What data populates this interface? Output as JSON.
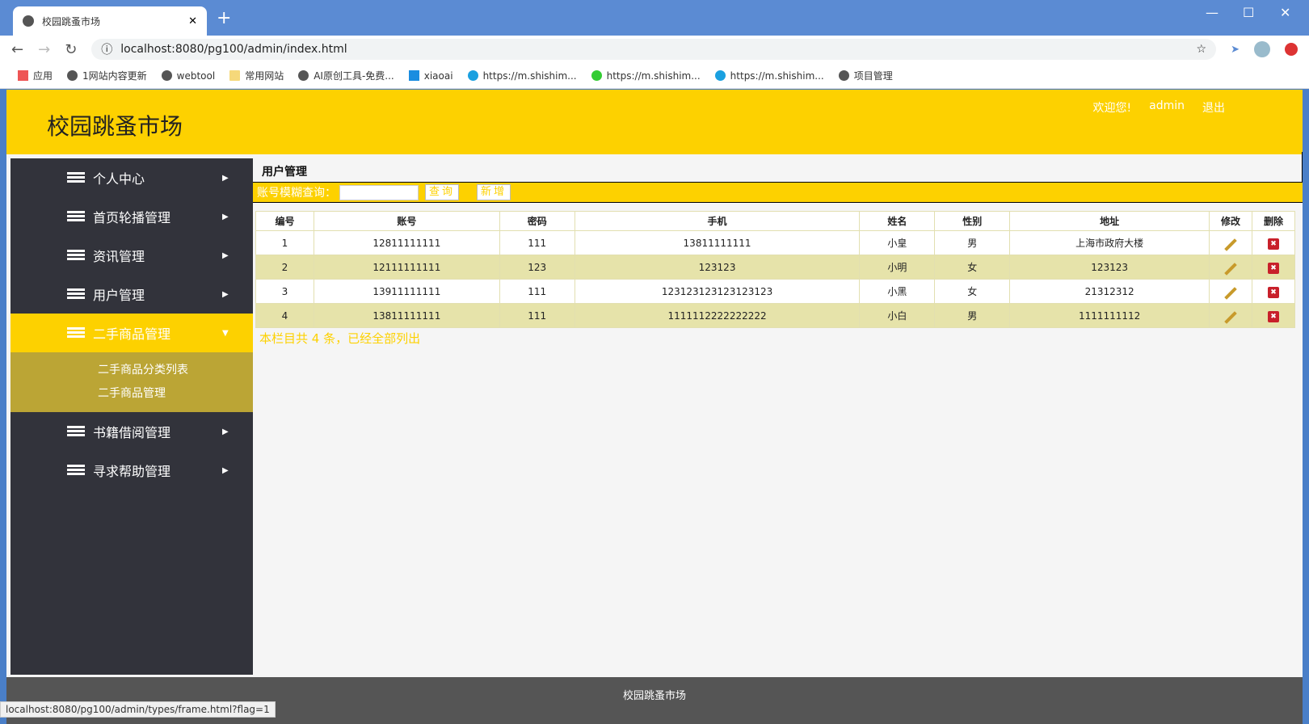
{
  "browser": {
    "tab_title": "校园跳蚤市场",
    "url": "localhost:8080/pg100/admin/index.html",
    "bookmarks": [
      "应用",
      "1网站内容更新",
      "webtool",
      "常用网站",
      "AI原创工具-免费...",
      "xiaoai",
      "https://m.shishim...",
      "https://m.shishim...",
      "https://m.shishim...",
      "项目管理"
    ],
    "status_url": "localhost:8080/pg100/admin/types/frame.html?flag=1"
  },
  "header": {
    "logo": "校园跳蚤市场",
    "welcome": "欢迎您!",
    "user": "admin",
    "logout": "退出"
  },
  "sidebar": {
    "items": [
      {
        "label": "个人中心"
      },
      {
        "label": "首页轮播管理"
      },
      {
        "label": "资讯管理"
      },
      {
        "label": "用户管理"
      },
      {
        "label": "二手商品管理",
        "active": true,
        "children": [
          "二手商品分类列表",
          "二手商品管理"
        ]
      },
      {
        "label": "书籍借阅管理"
      },
      {
        "label": "寻求帮助管理"
      }
    ]
  },
  "main": {
    "title": "用户管理",
    "search_label": "账号模糊查询：",
    "search_value": "",
    "query_btn": "查询",
    "add_btn": "新增",
    "columns": [
      "编号",
      "账号",
      "密码",
      "手机",
      "姓名",
      "性别",
      "地址",
      "修改",
      "删除"
    ],
    "rows": [
      [
        "1",
        "12811111111",
        "111",
        "13811111111",
        "小皇",
        "男",
        "上海市政府大楼"
      ],
      [
        "2",
        "12111111111",
        "123",
        "123123",
        "小明",
        "女",
        "123123"
      ],
      [
        "3",
        "13911111111",
        "111",
        "123123123123123123",
        "小黑",
        "女",
        "21312312"
      ],
      [
        "4",
        "13811111111",
        "111",
        "1111112222222222",
        "小白",
        "男",
        "1111111112"
      ]
    ],
    "count_text": "本栏目共 4 条，已经全部列出"
  },
  "footer": {
    "text": "校园跳蚤市场"
  },
  "colors": {
    "accent": "#fdd100",
    "sidebar": "#32333b",
    "submenu": "#bba535",
    "row_alt": "#e6e3aa"
  }
}
